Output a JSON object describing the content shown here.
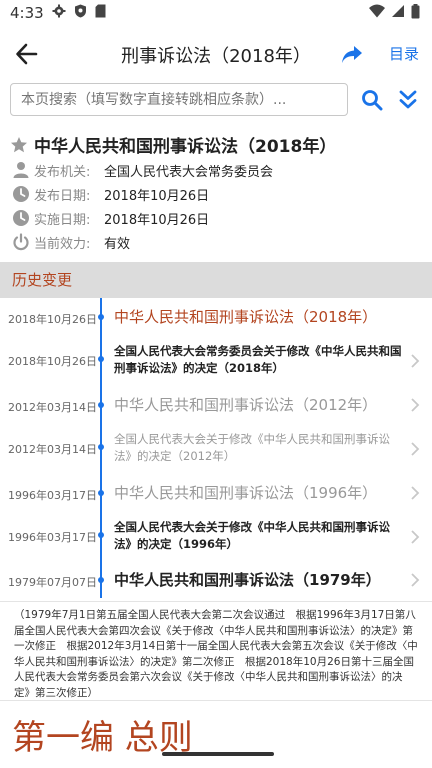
{
  "status_bar": {
    "time": "4:33"
  },
  "app_bar": {
    "title": "刑事诉讼法（2018年）",
    "toc_label": "目录"
  },
  "search": {
    "placeholder": "本页搜索（填写数字直接转跳相应条款）..."
  },
  "law": {
    "title": "中华人民共和国刑事诉讼法（2018年）",
    "meta": [
      {
        "label": "发布机关:",
        "value": "全国人民代表大会常务委员会",
        "icon": "person-icon"
      },
      {
        "label": "发布日期:",
        "value": "2018年10月26日",
        "icon": "clock-icon"
      },
      {
        "label": "实施日期:",
        "value": "2018年10月26日",
        "icon": "clock-icon"
      },
      {
        "label": "当前效力:",
        "value": "有效",
        "icon": "power-icon"
      }
    ]
  },
  "history": {
    "header": "历史变更",
    "items": [
      {
        "date": "2018年10月26日",
        "title": "中华人民共和国刑事诉讼法（2018年）",
        "style": "current"
      },
      {
        "date": "2018年10月26日",
        "title": "全国人民代表大会常务委员会关于修改《中华人民共和国刑事诉讼法》的决定（2018年）",
        "style": "amend-bold"
      },
      {
        "date": "2012年03月14日",
        "title": "中华人民共和国刑事诉讼法（2012年）",
        "style": "law-gray"
      },
      {
        "date": "2012年03月14日",
        "title": "全国人民代表大会关于修改《中华人民共和国刑事诉讼法》的决定（2012年）",
        "style": "amend-gray"
      },
      {
        "date": "1996年03月17日",
        "title": "中华人民共和国刑事诉讼法（1996年）",
        "style": "law-gray"
      },
      {
        "date": "1996年03月17日",
        "title": "全国人民代表大会关于修改《中华人民共和国刑事诉讼法》的决定（1996年）",
        "style": "amend-bold"
      },
      {
        "date": "1979年07月07日",
        "title": "中华人民共和国刑事诉讼法（1979年）",
        "style": "law-bold"
      }
    ]
  },
  "note": "（1979年7月1日第五届全国人民代表大会第二次会议通过　根据1996年3月17日第八届全国人民代表大会第四次会议《关于修改〈中华人民共和国刑事诉讼法〉的决定》第一次修正　根据2012年3月14日第十一届全国人民代表大会第五次会议《关于修改〈中华人民共和国刑事诉讼法〉的决定》第二次修正　根据2018年10月26日第十三届全国人民代表大会常务委员会第六次会议《关于修改〈中华人民共和国刑事诉讼法〉的决定》第三次修正）",
  "chapter_heading": "第一编 总则",
  "colors": {
    "accent": "#1a73e8",
    "history_red": "#b34520",
    "gray_text": "#999999",
    "band": "#dcdcdc"
  }
}
